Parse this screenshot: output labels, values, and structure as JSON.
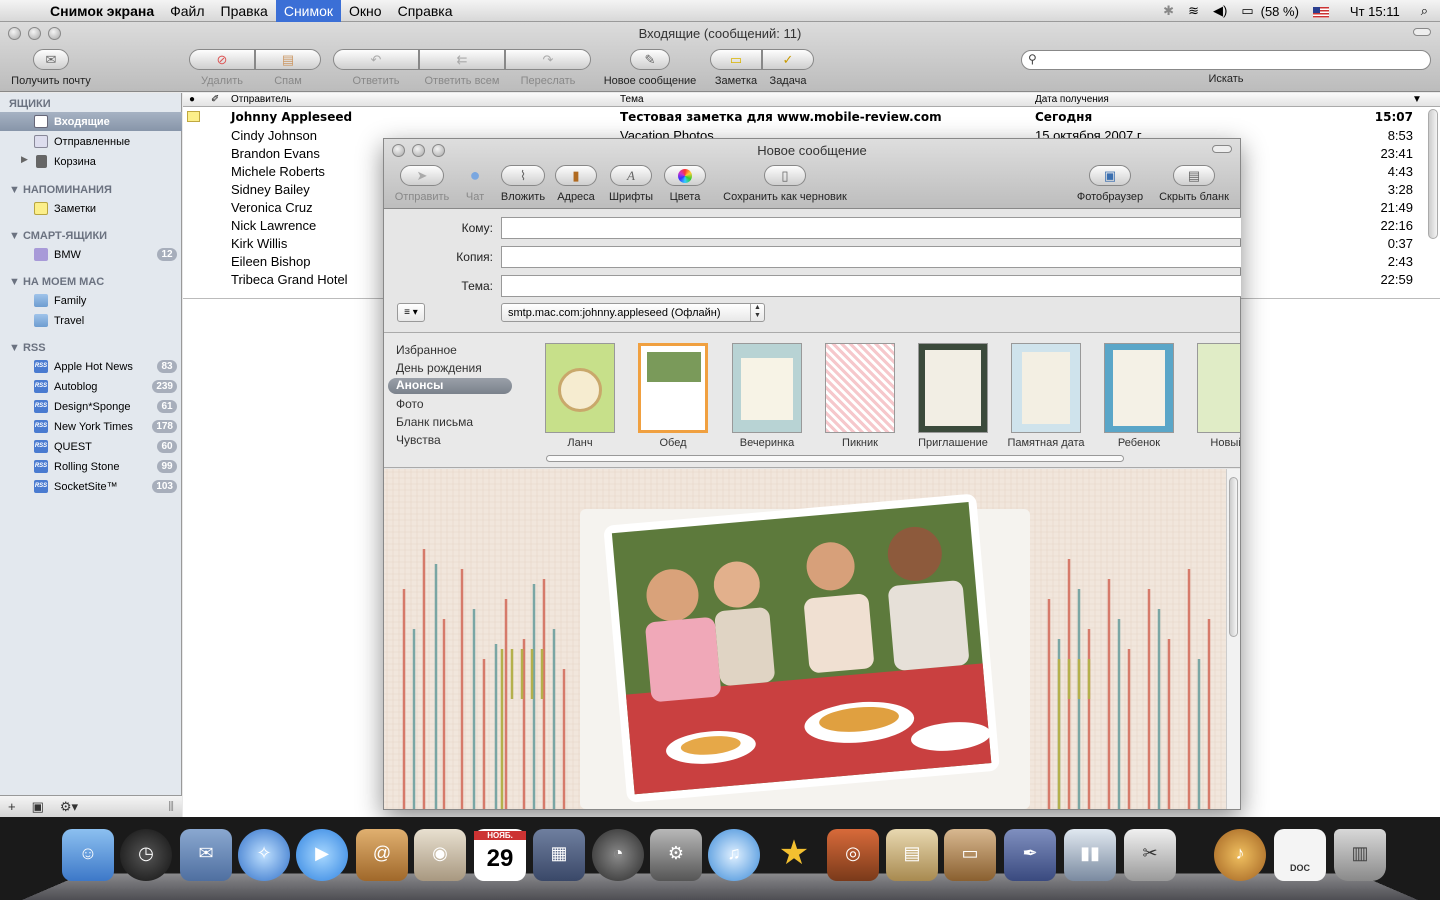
{
  "menubar": {
    "app": "Снимок экрана",
    "items": [
      "Файл",
      "Правка",
      "Снимок",
      "Окно",
      "Справка"
    ],
    "battery": "(58 %)",
    "clock": "Чт 15:11"
  },
  "mail": {
    "title": "Входящие (сообщений: 11)",
    "toolbar": {
      "get_mail": "Получить почту",
      "delete": "Удалить",
      "junk": "Спам",
      "reply": "Ответить",
      "reply_all": "Ответить всем",
      "forward": "Переслать",
      "new_message": "Новое сообщение",
      "note": "Заметка",
      "todo": "Задача",
      "search_label": "Искать"
    },
    "sidebar": {
      "mailboxes_header": "ЯЩИКИ",
      "inbox": "Входящие",
      "sent": "Отправленные",
      "trash": "Корзина",
      "reminders_header": "НАПОМИНАНИЯ",
      "notes": "Заметки",
      "smart_header": "СМАРТ-ЯЩИКИ",
      "smart": [
        {
          "label": "BMW",
          "count": "12"
        }
      ],
      "onmac_header": "НА МОЕМ MAC",
      "onmac": [
        "Family",
        "Travel"
      ],
      "rss_header": "RSS",
      "rss": [
        {
          "label": "Apple Hot News",
          "count": "83"
        },
        {
          "label": "Autoblog",
          "count": "239"
        },
        {
          "label": "Design*Sponge",
          "count": "61"
        },
        {
          "label": "New York Times",
          "count": "178"
        },
        {
          "label": "QUEST",
          "count": "60"
        },
        {
          "label": "Rolling Stone",
          "count": "99"
        },
        {
          "label": "SocketSite™",
          "count": "103"
        }
      ],
      "rss_icon_text": "RSS"
    },
    "columns": {
      "from": "Отправитель",
      "subject": "Тема",
      "date": "Дата получения"
    },
    "messages": [
      {
        "from": "Johnny Appleseed",
        "subject": "Тестовая заметка для www.mobile-review.com",
        "date": "Сегодня",
        "time": "15:07"
      },
      {
        "from": "Cindy Johnson",
        "subject": "Vacation Photos",
        "date": "15 октября 2007 г.",
        "time": "8:53"
      },
      {
        "from": "Brandon Evans",
        "subject": "",
        "date": "",
        "time": "23:41"
      },
      {
        "from": "Michele Roberts",
        "subject": "",
        "date": "",
        "time": "4:43"
      },
      {
        "from": "Sidney Bailey",
        "subject": "",
        "date": "",
        "time": "3:28"
      },
      {
        "from": "Veronica Cruz",
        "subject": "",
        "date": "",
        "time": "21:49"
      },
      {
        "from": "Nick Lawrence",
        "subject": "",
        "date": "",
        "time": "22:16"
      },
      {
        "from": "Kirk Willis",
        "subject": "",
        "date": "",
        "time": "0:37"
      },
      {
        "from": "Eileen Bishop",
        "subject": "",
        "date": "",
        "time": "2:43"
      },
      {
        "from": "Tribeca Grand Hotel",
        "subject": "",
        "date": "",
        "time": "22:59"
      }
    ]
  },
  "compose": {
    "title": "Новое сообщение",
    "toolbar": {
      "send": "Отправить",
      "chat": "Чат",
      "attach": "Вложить",
      "address": "Адреса",
      "fonts": "Шрифты",
      "colors": "Цвета",
      "save_draft": "Сохранить как черновик",
      "photo_browser": "Фотобраузер",
      "hide_stationery": "Скрыть бланк"
    },
    "to_label": "Кому:",
    "cc_label": "Копия:",
    "subject_label": "Тема:",
    "account": "smtp.mac.com:johnny.appleseed (Офлайн)",
    "categories": [
      "Избранное",
      "День рождения",
      "Анонсы",
      "Фото",
      "Бланк письма",
      "Чувства"
    ],
    "selected_category": "Анонсы",
    "templates": [
      "Ланч",
      "Обед",
      "Вечеринка",
      "Пикник",
      "Приглашение",
      "Памятная дата",
      "Ребенок",
      "Новый а"
    ],
    "selected_template": "Обед"
  },
  "dock": {
    "calendar_day": "29",
    "calendar_month": "НОЯБ.",
    "doc_label": "DOC"
  },
  "colors": {
    "selection": "#3b6fd6",
    "sidebar_bg": "#e3e8ee",
    "badge": "#a7aebb"
  }
}
